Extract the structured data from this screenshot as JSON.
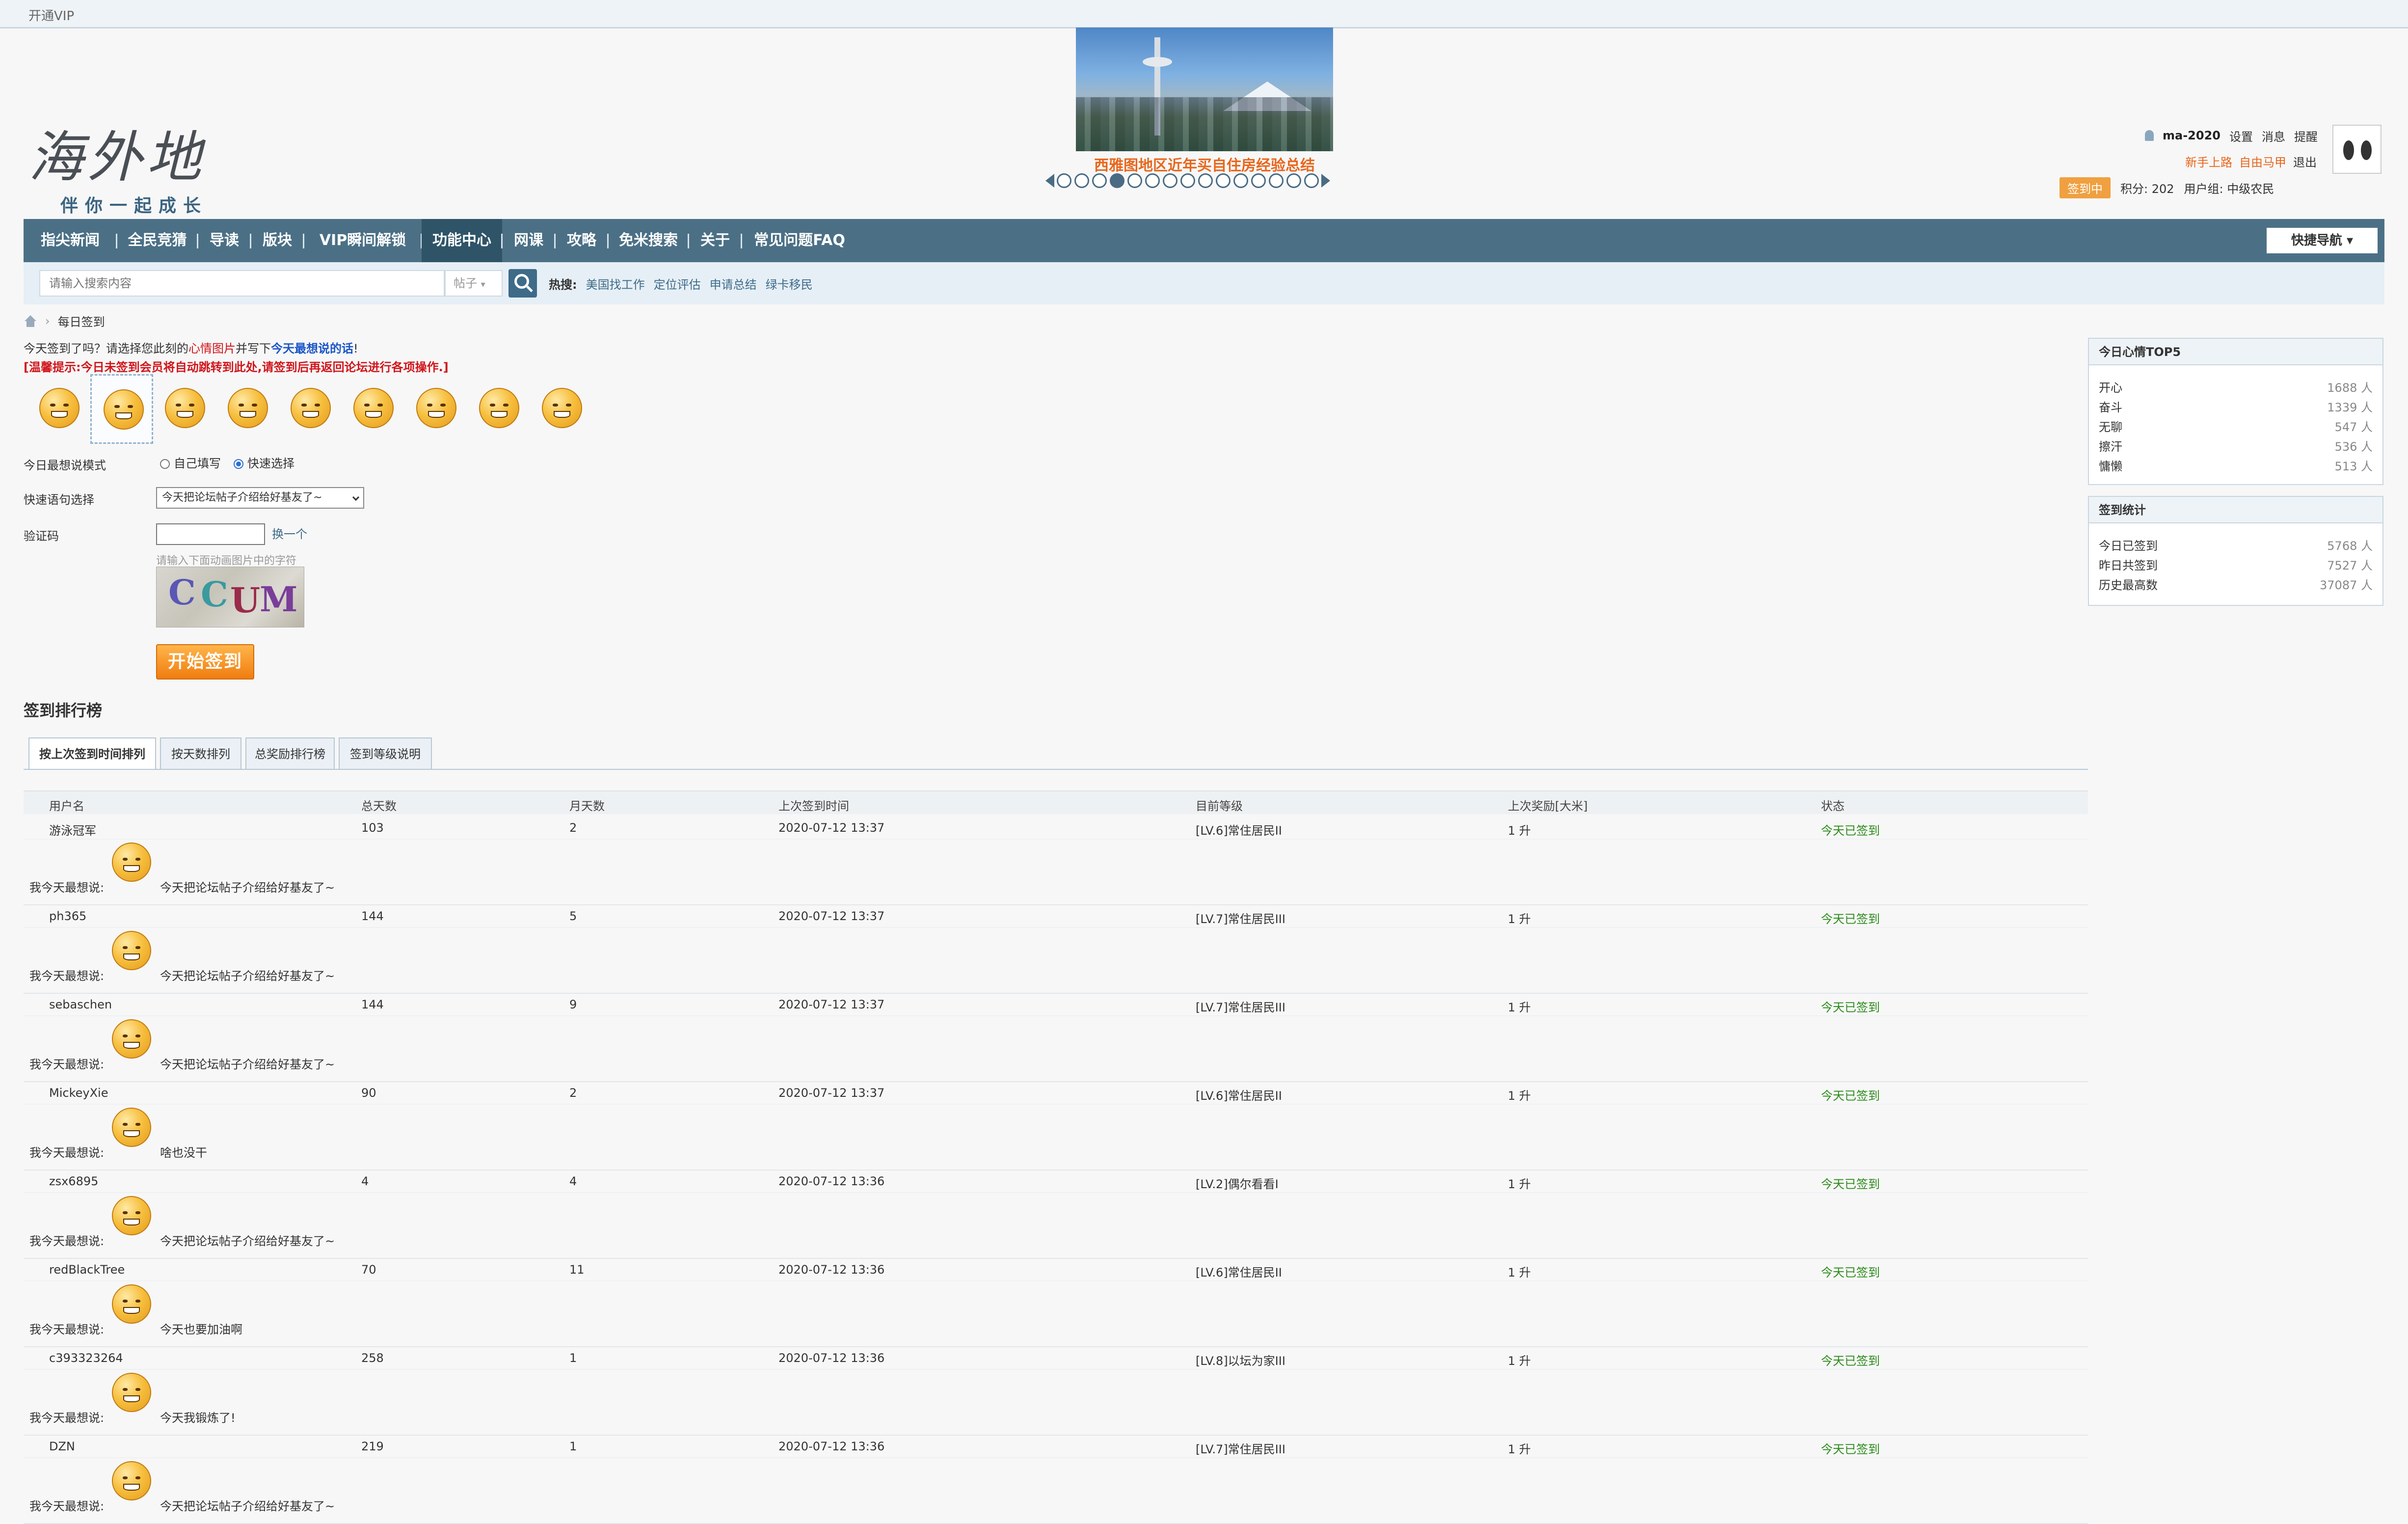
{
  "topbar": {
    "vip_link": "开通VIP"
  },
  "logo": {
    "art_text": "海外地",
    "slogan": "伴你一起成长"
  },
  "banner": {
    "caption": "西雅图地区近年买自住房经验总结",
    "dots_total": 15,
    "dots_active": 3
  },
  "user": {
    "name": "ma-2020",
    "links": [
      "设置",
      "消息",
      "提醒"
    ],
    "links2": [
      "新手上路",
      "自由马甲",
      "退出"
    ],
    "signin_badge": "签到中",
    "points": "积分: 202",
    "group": "用户组: 中级农民"
  },
  "nav": {
    "items": [
      "指尖新闻",
      "全民竞猜",
      "导读",
      "版块",
      "VIP瞬间解锁",
      "功能中心",
      "网课",
      "攻略",
      "免米搜索",
      "关于",
      "常见问题FAQ"
    ],
    "active_index": 5,
    "quick_nav": "快捷导航"
  },
  "search": {
    "placeholder": "请输入搜索内容",
    "scope": "帖子",
    "hot_label": "热搜:",
    "hot_links": [
      "美国找工作",
      "定位评估",
      "申请总结",
      "绿卡移民"
    ]
  },
  "breadcrumb": {
    "current": "每日签到"
  },
  "prompt": {
    "line1_a": "今天签到了吗？请选择您此刻的",
    "line1_b": "心情图片",
    "line1_c": "并写下",
    "line1_d": "今天最想说的话",
    "line1_e": "!",
    "line2": "[温馨提示:今日未签到会员将自动跳转到此处,请签到后再返回论坛进行各项操作.]"
  },
  "moods": {
    "count": 9,
    "selected_index": 1
  },
  "form": {
    "mode_label": "今日最想说模式",
    "mode_options": [
      "自己填写",
      "快速选择"
    ],
    "mode_selected": 1,
    "quick_label": "快速语句选择",
    "quick_value": "今天把论坛帖子介绍给好基友了~",
    "captcha_label": "验证码",
    "captcha_refresh": "换一个",
    "captcha_hint": "请输入下面动画图片中的字符",
    "captcha_chars": [
      "C",
      "C",
      "U",
      "M"
    ],
    "submit_label": "开始签到"
  },
  "sidebar": {
    "mood_top": {
      "title": "今日心情TOP5",
      "rows": [
        {
          "name": "开心",
          "count": "1688 人"
        },
        {
          "name": "奋斗",
          "count": "1339 人"
        },
        {
          "name": "无聊",
          "count": "547 人"
        },
        {
          "name": "擦汗",
          "count": "536 人"
        },
        {
          "name": "慵懒",
          "count": "513 人"
        }
      ]
    },
    "stats": {
      "title": "签到统计",
      "rows": [
        {
          "name": "今日已签到",
          "count": "5768 人"
        },
        {
          "name": "昨日共签到",
          "count": "7527 人"
        },
        {
          "name": "历史最高数",
          "count": "37087 人"
        }
      ]
    }
  },
  "ranking": {
    "title": "签到排行榜",
    "tabs": [
      "按上次签到时间排列",
      "按天数排列",
      "总奖励排行榜",
      "签到等级说明"
    ],
    "active_tab": 0,
    "headers": [
      "用户名",
      "总天数",
      "月天数",
      "上次签到时间",
      "目前等级",
      "上次奖励[大米]",
      "状态"
    ],
    "said_label": "我今天最想说:",
    "rows": [
      {
        "user": "游泳冠军",
        "total": "103",
        "month": "2",
        "time": "2020-07-12 13:37",
        "level": "[LV.6]常住居民II",
        "reward": "1 升",
        "status": "今天已签到",
        "msg": "今天把论坛帖子介绍给好基友了~"
      },
      {
        "user": "ph365",
        "total": "144",
        "month": "5",
        "time": "2020-07-12 13:37",
        "level": "[LV.7]常住居民III",
        "reward": "1 升",
        "status": "今天已签到",
        "msg": "今天把论坛帖子介绍给好基友了~"
      },
      {
        "user": "sebaschen",
        "total": "144",
        "month": "9",
        "time": "2020-07-12 13:37",
        "level": "[LV.7]常住居民III",
        "reward": "1 升",
        "status": "今天已签到",
        "msg": "今天把论坛帖子介绍给好基友了~"
      },
      {
        "user": "MickeyXie",
        "total": "90",
        "month": "2",
        "time": "2020-07-12 13:37",
        "level": "[LV.6]常住居民II",
        "reward": "1 升",
        "status": "今天已签到",
        "msg": "啥也没干"
      },
      {
        "user": "zsx6895",
        "total": "4",
        "month": "4",
        "time": "2020-07-12 13:36",
        "level": "[LV.2]偶尔看看I",
        "reward": "1 升",
        "status": "今天已签到",
        "msg": "今天把论坛帖子介绍给好基友了~"
      },
      {
        "user": "redBlackTree",
        "total": "70",
        "month": "11",
        "time": "2020-07-12 13:36",
        "level": "[LV.6]常住居民II",
        "reward": "1 升",
        "status": "今天已签到",
        "msg": "今天也要加油啊"
      },
      {
        "user": "c393323264",
        "total": "258",
        "month": "1",
        "time": "2020-07-12 13:36",
        "level": "[LV.8]以坛为家III",
        "reward": "1 升",
        "status": "今天已签到",
        "msg": "今天我锻炼了!"
      },
      {
        "user": "DZN",
        "total": "219",
        "month": "1",
        "time": "2020-07-12 13:36",
        "level": "[LV.7]常住居民III",
        "reward": "1 升",
        "status": "今天已签到",
        "msg": "今天把论坛帖子介绍给好基友了~"
      }
    ]
  }
}
